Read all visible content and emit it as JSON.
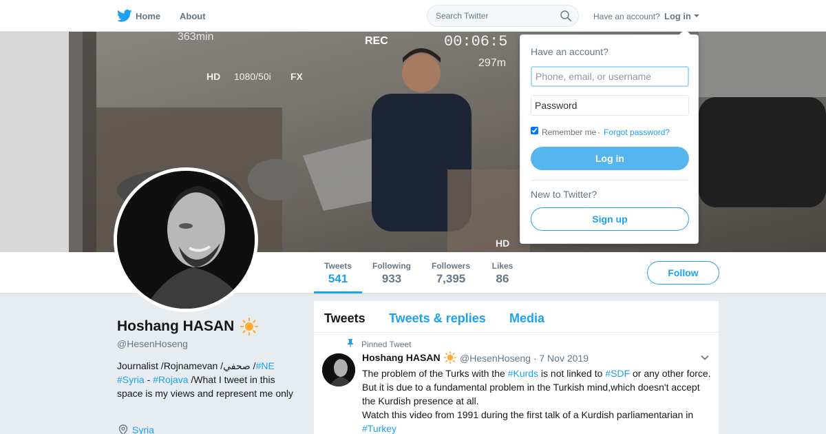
{
  "nav": {
    "logo_icon": "twitter-bird-icon",
    "home_label": "Home",
    "about_label": "About",
    "search_placeholder": "Search Twitter",
    "search_icon": "search-icon",
    "have_account": "Have an account?",
    "login_label": "Log in"
  },
  "banner": {
    "overlay_texts": [
      "REC",
      "00:06:5",
      "297m",
      "HD",
      "1080/50i",
      "FX",
      "363min",
      "HD"
    ]
  },
  "profile": {
    "name": "Hoshang HASAN",
    "name_emoji": "sun-icon",
    "handle": "@HesenHoseng",
    "bio": {
      "part1": "Journalist /Rojnamevan /صحفي /",
      "tag1": "#NE",
      "tag2": "#Syria",
      "dash": " - ",
      "tag3": "#Rojava",
      "part2": " /What I tweet in this space is my views and represent me only"
    },
    "location": "Syria",
    "follow_label": "Follow"
  },
  "stats": [
    {
      "label": "Tweets",
      "value": "541"
    },
    {
      "label": "Following",
      "value": "933"
    },
    {
      "label": "Followers",
      "value": "7,395"
    },
    {
      "label": "Likes",
      "value": "86"
    }
  ],
  "timeline": {
    "tabs": [
      "Tweets",
      "Tweets & replies",
      "Media"
    ],
    "pinned_label": "Pinned Tweet",
    "tweet": {
      "name": "Hoshang HASAN",
      "meta": "@HesenHoseng · 7 Nov 2019",
      "text_a": "The problem of the Turks with the ",
      "tag_kurds": "#Kurds",
      "text_b": " is not linked to ",
      "tag_sdf": "#SDF",
      "text_c": " or any other force. But it is due to a fundamental problem in the Turkish mind,which doesn't accept the Kurdish presence at all.",
      "text_d": "Watch this video from 1991 during the first talk of a Kurdish parliamentarian in ",
      "tag_turkey": "#Turkey"
    }
  },
  "login_dropdown": {
    "title": "Have an account?",
    "username_placeholder": "Phone, email, or username",
    "password_placeholder": "Password",
    "remember_label": "Remember me",
    "separator": "·",
    "forgot_label": "Forgot password?",
    "login_button": "Log in",
    "new_label": "New to Twitter?",
    "signup_button": "Sign up"
  }
}
